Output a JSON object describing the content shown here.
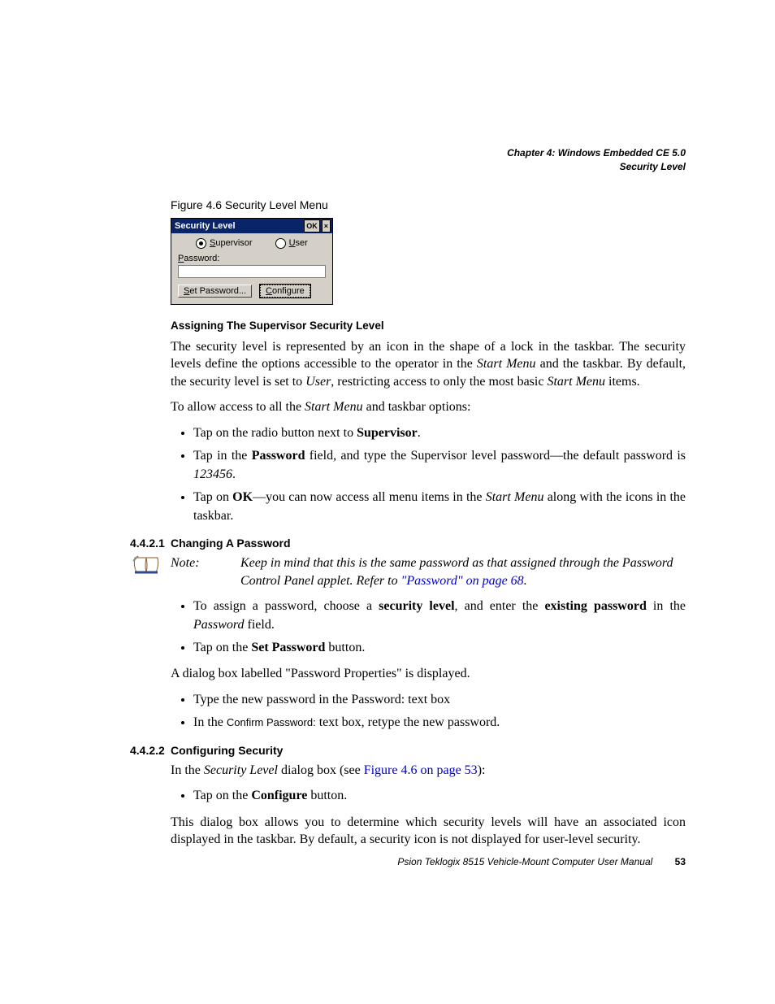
{
  "header": {
    "chapter": "Chapter 4: Windows Embedded CE 5.0",
    "section": "Security Level"
  },
  "figure": {
    "caption": "Figure 4.6  Security Level Menu",
    "dialog": {
      "title": "Security Level",
      "ok": "OK",
      "close": "×",
      "radio_supervisor_prefix": "S",
      "radio_supervisor_rest": "upervisor",
      "radio_user_prefix": "U",
      "radio_user_rest": "ser",
      "password_label_prefix": "P",
      "password_label_rest": "assword:",
      "btn_set_prefix": "S",
      "btn_set_rest": "et Password...",
      "btn_configure_prefix": "C",
      "btn_configure_rest": "onfigure"
    }
  },
  "heading1": "Assigning The Supervisor Security Level",
  "p1a": "The security level is represented by an icon in the shape of a lock in the taskbar. The security levels define the options accessible to the operator in the ",
  "p1b": "Start Menu",
  "p1c": " and the taskbar. By default, the security level is set to ",
  "p1d": "User",
  "p1e": ", restricting access to only the most basic ",
  "p1f": "Start Menu",
  "p1g": " items.",
  "p2a": "To allow access to all the ",
  "p2b": "Start Menu",
  "p2c": " and taskbar options:",
  "b1a": "Tap on the radio button next to ",
  "b1b": "Supervisor",
  "b1c": ".",
  "b2a": "Tap in the ",
  "b2b": "Password",
  "b2c": " field, and type the Supervisor level password—the default password is ",
  "b2d": "123456",
  "b2e": ".",
  "b3a": "Tap on ",
  "b3b": "OK",
  "b3c": "—you can now access all menu items in the ",
  "b3d": "Start Menu",
  "b3e": " along with the icons in the taskbar.",
  "sec1": {
    "num": "4.4.2.1",
    "title": "Changing A Password"
  },
  "note1": {
    "label": "Note:",
    "text_a": "Keep in mind that this is the same password as that assigned through the Password Control Panel applet. Refer to ",
    "link": "\"Password\" on page 68",
    "text_b": "."
  },
  "c1a": "To assign a password, choose a ",
  "c1b": "security level",
  "c1c": ", and enter the ",
  "c1d": "existing password",
  "c1e": " in the ",
  "c1f": "Password",
  "c1g": " field.",
  "c2a": "Tap on the ",
  "c2b": "Set Password",
  "c2c": " button.",
  "p3": "A dialog box labelled \"Password Properties\" is displayed.",
  "d1": "Type the new password in the Password: text box",
  "d2a": "In the ",
  "d2b": "Confirm Password:",
  "d2c": " text box, retype the new password.",
  "sec2": {
    "num": "4.4.2.2",
    "title": "Configuring Security"
  },
  "p4a": "In the ",
  "p4b": "Security Level",
  "p4c": " dialog box (see ",
  "p4link": "Figure 4.6 on page 53",
  "p4d": "):",
  "e1a": "Tap on the ",
  "e1b": "Configure",
  "e1c": " button.",
  "p5": "This dialog box allows you to determine which security levels will have an associated icon displayed in the taskbar. By default, a security icon is not displayed for user-level security.",
  "footer": {
    "text": "Psion Teklogix 8515 Vehicle-Mount Computer User Manual",
    "page": "53"
  }
}
